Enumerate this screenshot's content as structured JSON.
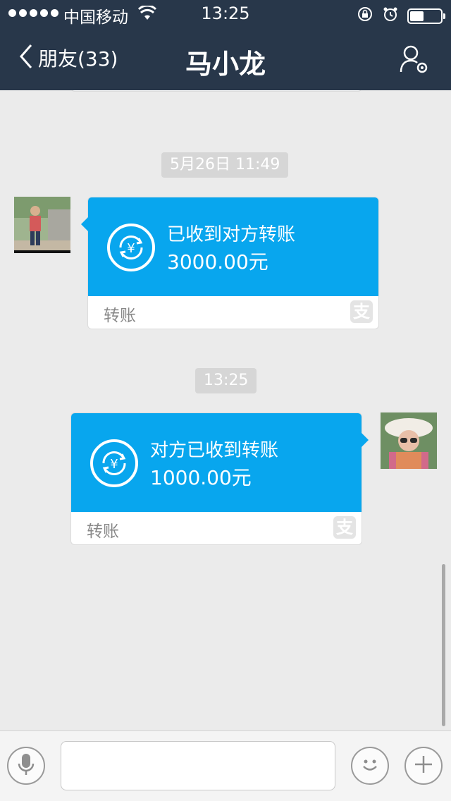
{
  "status_bar": {
    "carrier": "中国移动",
    "time": "13:25",
    "battery_level": 0.45
  },
  "nav": {
    "back_label": "朋友(33)",
    "title": "马小龙",
    "icons": {
      "back": "chevron-left-icon",
      "profile": "user-settings-icon"
    }
  },
  "chat": {
    "previous_card": {
      "label": "转账"
    },
    "messages": [
      {
        "timestamp": "5月26日 11:49",
        "side": "left",
        "title": "已收到对方转账",
        "amount": "3000.00元",
        "footer": "转账"
      },
      {
        "timestamp": "13:25",
        "side": "right",
        "title": "对方已收到转账",
        "amount": "1000.00元",
        "footer": "转账"
      }
    ]
  },
  "input_bar": {
    "placeholder": "",
    "icons": {
      "voice": "microphone-icon",
      "emoji": "smiley-icon",
      "more": "plus-icon"
    }
  },
  "colors": {
    "header_bg": "#28374a",
    "card_blue": "#08a6ee",
    "chat_bg": "#ebebeb"
  }
}
